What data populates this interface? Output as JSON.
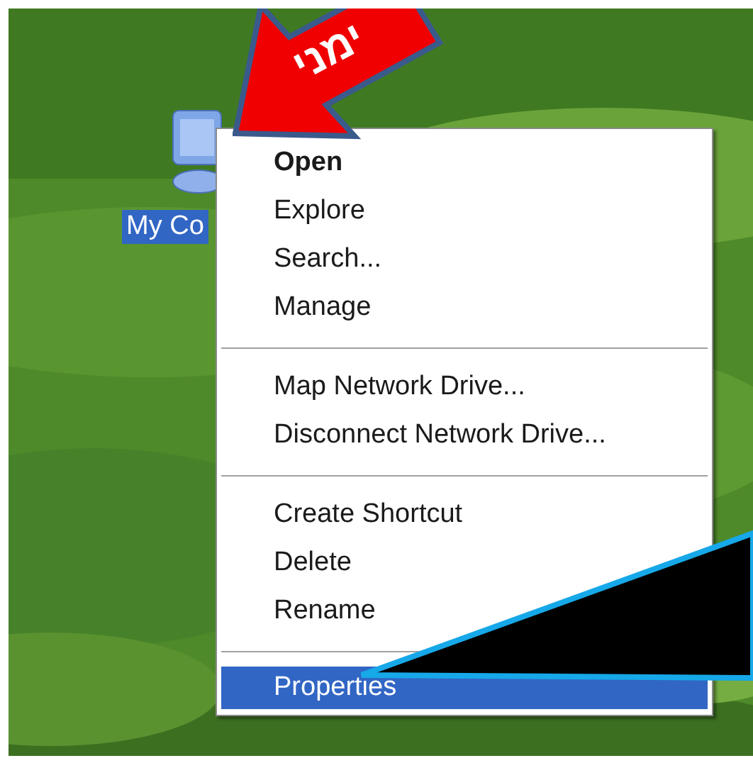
{
  "desktop_icon": {
    "label": "My Co",
    "selected": true
  },
  "context_menu": [
    {
      "kind": "item",
      "label": "Open",
      "default": true,
      "selected": false
    },
    {
      "kind": "item",
      "label": "Explore",
      "default": false,
      "selected": false
    },
    {
      "kind": "item",
      "label": "Search...",
      "default": false,
      "selected": false
    },
    {
      "kind": "item",
      "label": "Manage",
      "default": false,
      "selected": false
    },
    {
      "kind": "separator"
    },
    {
      "kind": "item",
      "label": "Map Network Drive...",
      "default": false,
      "selected": false
    },
    {
      "kind": "item",
      "label": "Disconnect Network Drive...",
      "default": false,
      "selected": false
    },
    {
      "kind": "separator"
    },
    {
      "kind": "item",
      "label": "Create Shortcut",
      "default": false,
      "selected": false
    },
    {
      "kind": "item",
      "label": "Delete",
      "default": false,
      "selected": false
    },
    {
      "kind": "item",
      "label": "Rename",
      "default": false,
      "selected": false
    },
    {
      "kind": "separator"
    },
    {
      "kind": "item",
      "label": "Properties",
      "default": false,
      "selected": true
    }
  ],
  "annotation": {
    "label": "ימני"
  }
}
